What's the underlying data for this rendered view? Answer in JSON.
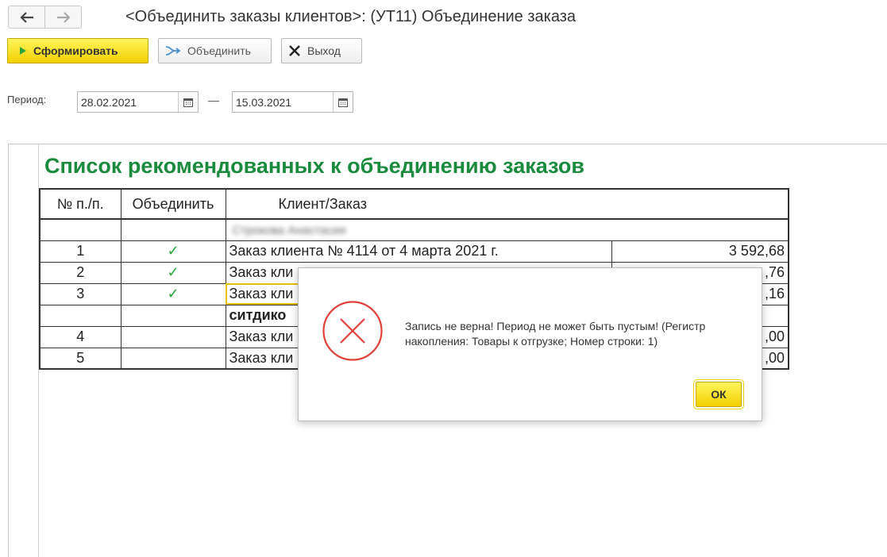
{
  "window": {
    "title": "<Объединить заказы клиентов>: (УТ11) Объединение заказа"
  },
  "toolbar": {
    "generate_label": "Сформировать",
    "merge_label": "Объединить",
    "exit_label": "Выход"
  },
  "period": {
    "label": "Период:",
    "from": "28.02.2021",
    "to": "15.03.2021",
    "separator": "—"
  },
  "report": {
    "title": "Список рекомендованных к объединению заказов",
    "columns": [
      "№ п./п.",
      "Объединить",
      "Клиент/Заказ"
    ],
    "groups": [
      {
        "client": "Строкова Анастасия",
        "rows": [
          {
            "num": "1",
            "merge": "✓",
            "order": "Заказ клиента № 4114 от 4 марта 2021 г.",
            "sum": "3 592,68"
          },
          {
            "num": "2",
            "merge": "✓",
            "order": "Заказ кли",
            "sum": ",76"
          },
          {
            "num": "3",
            "merge": "✓",
            "order": "Заказ кли",
            "sum": ",16"
          }
        ]
      },
      {
        "client": "ситдико",
        "rows": [
          {
            "num": "4",
            "merge": "",
            "order": "Заказ кли",
            "sum": ",00"
          },
          {
            "num": "5",
            "merge": "",
            "order": "Заказ кли",
            "sum": ",00"
          }
        ]
      }
    ]
  },
  "dialog": {
    "message": "Запись не верна! Период не может быть пустым! (Регистр накопления: Товары к отгрузке; Номер строки: 1)",
    "ok_label": "ОК",
    "icon": "error-icon"
  },
  "colors": {
    "accent_yellow": "#f2d000",
    "title_green": "#1a8a3d",
    "error_red": "#e0413b",
    "check_green": "#2aa53a"
  }
}
